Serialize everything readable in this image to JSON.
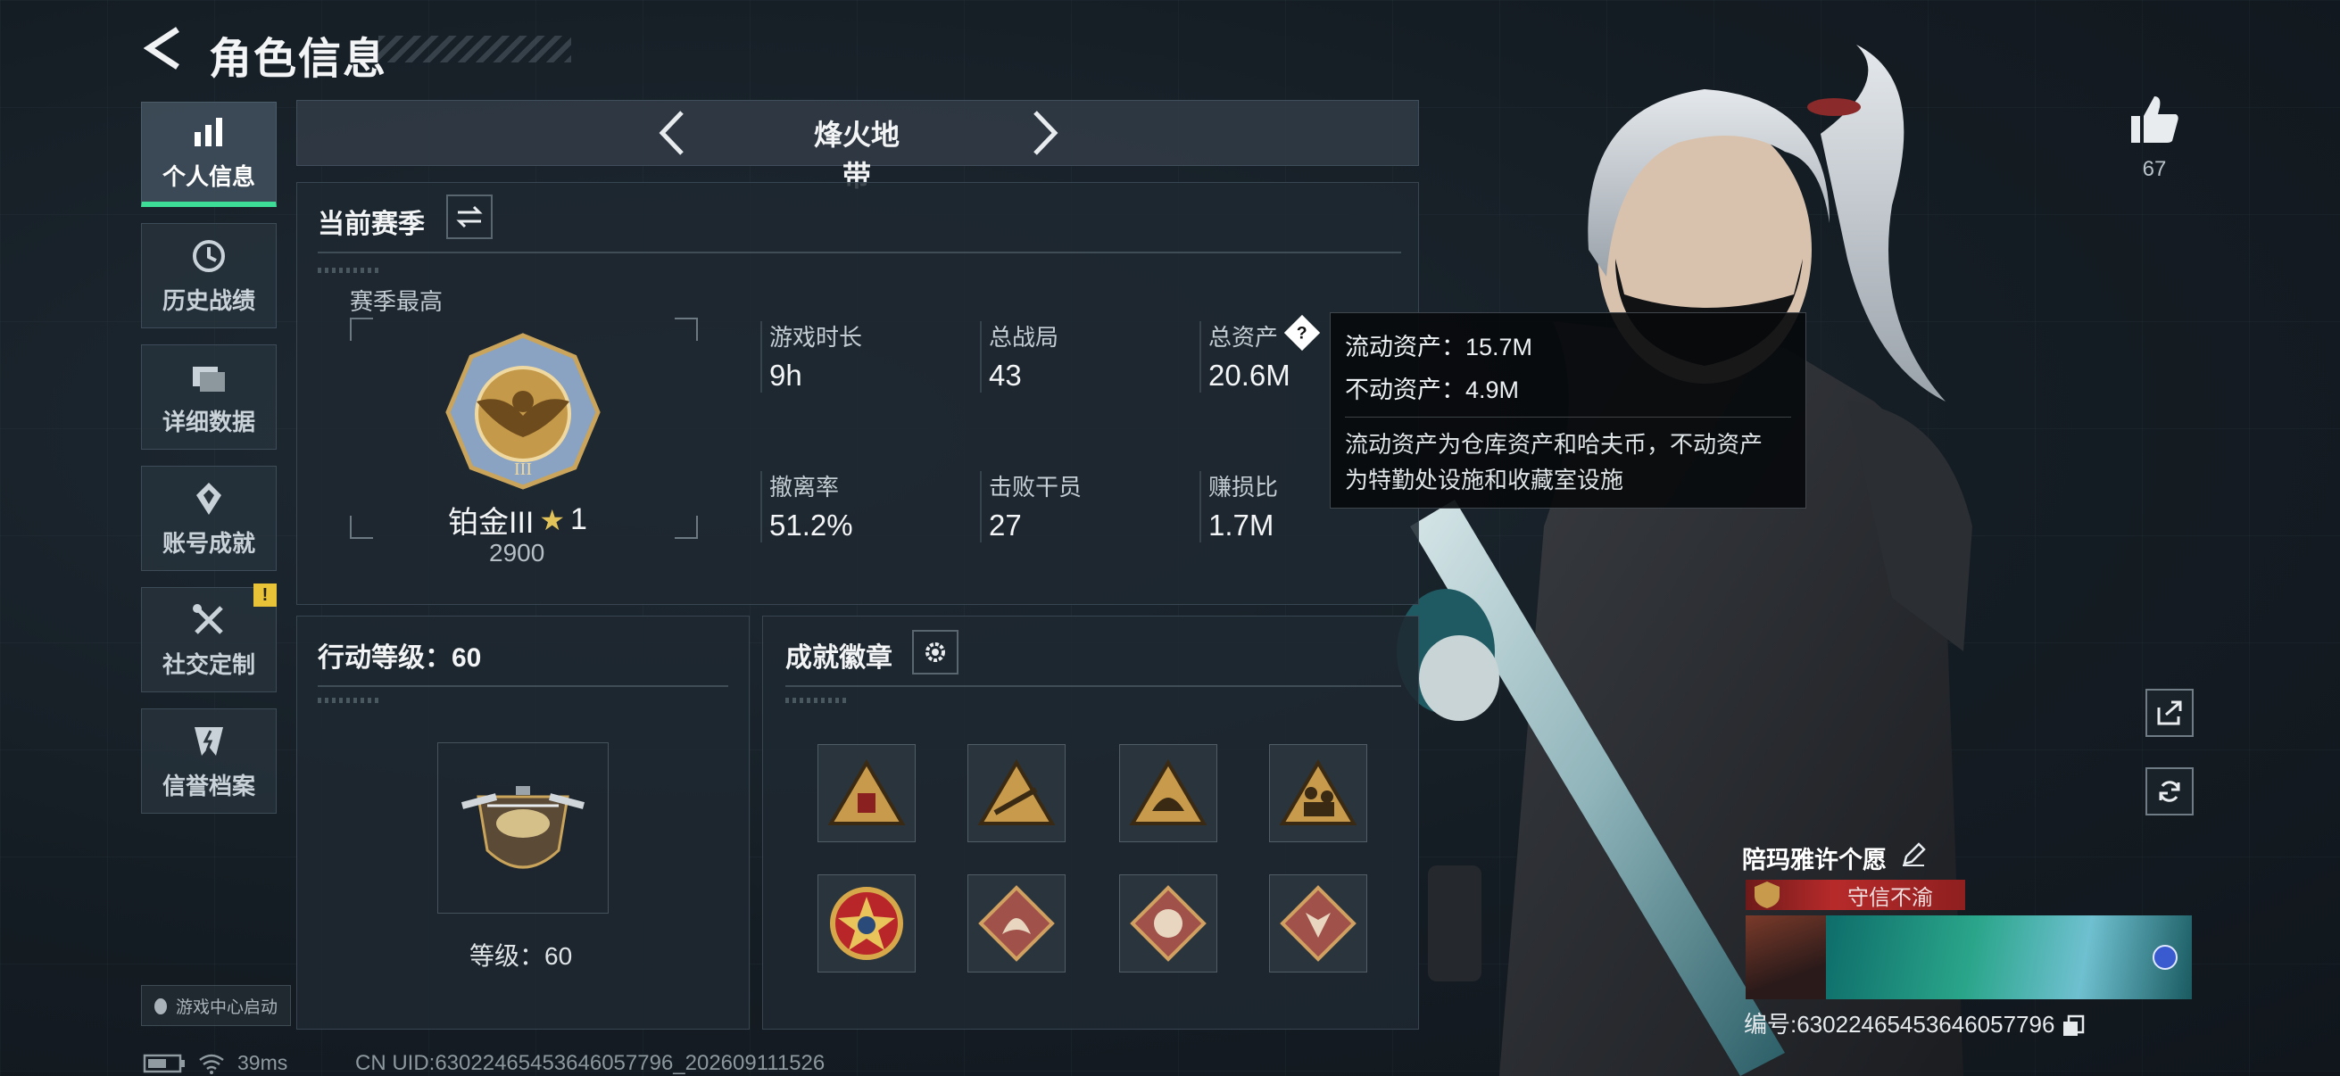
{
  "header": {
    "title": "角色信息"
  },
  "sidebar": {
    "items": [
      {
        "label": "个人信息",
        "icon": "bar-chart-icon",
        "active": true
      },
      {
        "label": "历史战绩",
        "icon": "history-clock-icon",
        "active": false
      },
      {
        "label": "详细数据",
        "icon": "folders-icon",
        "active": false
      },
      {
        "label": "账号成就",
        "icon": "achievement-icon",
        "active": false
      },
      {
        "label": "社交定制",
        "icon": "tools-icon",
        "active": false,
        "badge": "!"
      },
      {
        "label": "信誉档案",
        "icon": "credit-shield-icon",
        "active": false
      }
    ],
    "game_center": "游戏中心启动"
  },
  "mode": {
    "title": "烽火地带"
  },
  "season": {
    "title": "当前赛季",
    "best_label": "赛季最高",
    "rank_name": "铂金III",
    "rank_stars": "1",
    "rank_score": "2900",
    "stats": [
      {
        "label": "游戏时长",
        "value": "9h"
      },
      {
        "label": "总战局",
        "value": "43"
      },
      {
        "label": "总资产",
        "value": "20.6M"
      },
      {
        "label": "撤离率",
        "value": "51.2%"
      },
      {
        "label": "击败干员",
        "value": "27"
      },
      {
        "label": "赚损比",
        "value": "1.7M"
      }
    ]
  },
  "action_level": {
    "title": "行动等级：60",
    "level_text": "等级：60"
  },
  "achievements": {
    "title": "成就徽章",
    "badges": [
      "badge-crate-icon",
      "badge-rifle-icon",
      "badge-helmet-icon",
      "badge-soldiers-icon",
      "badge-star-medal-icon",
      "badge-dragon-icon",
      "badge-tiger-icon",
      "badge-wolf-icon"
    ]
  },
  "tooltip": {
    "liquid": "流动资产：15.7M",
    "fixed": "不动资产：4.9M",
    "desc_line1": "流动资产为仓库资产和哈夫币，不动资产",
    "desc_line2": "为特勤处设施和收藏室设施"
  },
  "likes": {
    "count": "67"
  },
  "player": {
    "name": "陪玛雅许个愿",
    "title": "守信不渝",
    "id": "编号:63022465453646057796"
  },
  "status": {
    "ping": "39ms",
    "uid": "CN UID:63022465453646057796_202609111526"
  },
  "colors": {
    "accent": "#3ddc97",
    "warning": "#e8c338",
    "banner": "#b72a2a"
  }
}
